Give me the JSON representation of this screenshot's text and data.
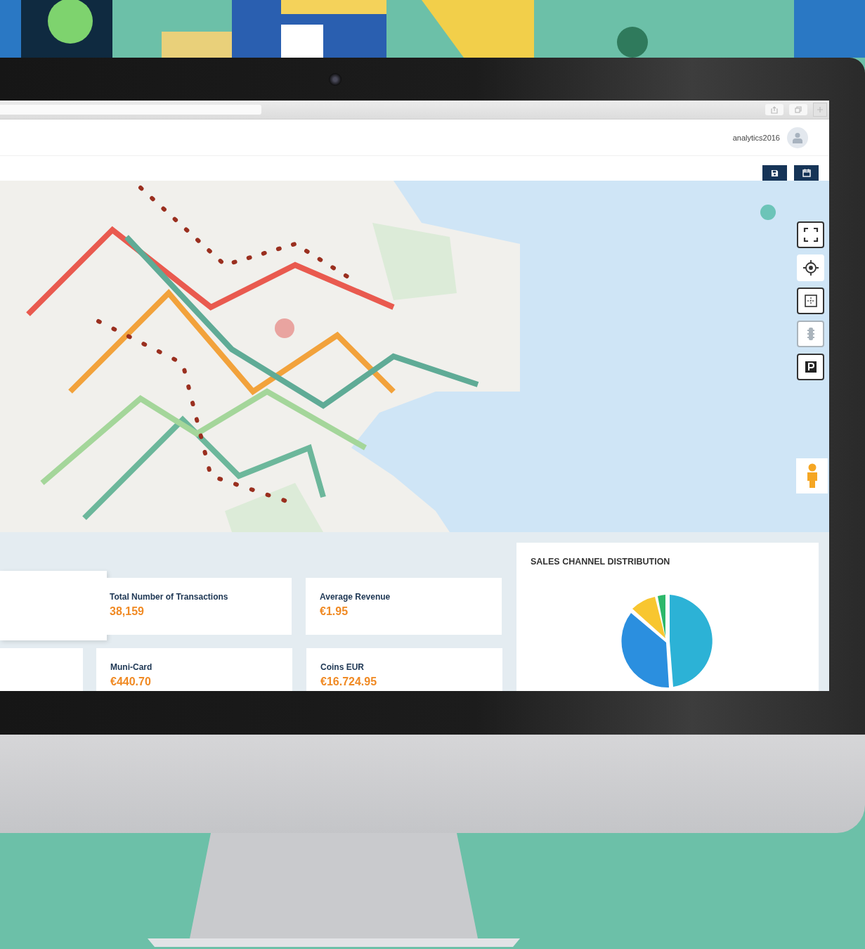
{
  "header": {
    "username": "analytics2016"
  },
  "toolbar": {
    "buttons": [
      {
        "kind": "save"
      },
      {
        "kind": "calendar"
      }
    ]
  },
  "map": {
    "controls": [
      {
        "kind": "fullscreen",
        "disabled": false
      },
      {
        "kind": "locate",
        "disabled": false
      },
      {
        "kind": "fit",
        "disabled": false
      },
      {
        "kind": "traffic",
        "disabled": true
      },
      {
        "kind": "parking",
        "disabled": false
      }
    ]
  },
  "kpi_rows": [
    [
      {
        "label": "Total Number of Transactions",
        "value": "38,159"
      },
      {
        "label": "Average Revenue",
        "value": "€1.95"
      }
    ],
    [
      {
        "label": "Muni-Card",
        "value": "€440.70"
      },
      {
        "label": "Coins EUR",
        "value": "€16.724.95"
      }
    ]
  ],
  "sales_chart": {
    "title": "SALES CHANNEL DISTRIBUTION"
  }
}
